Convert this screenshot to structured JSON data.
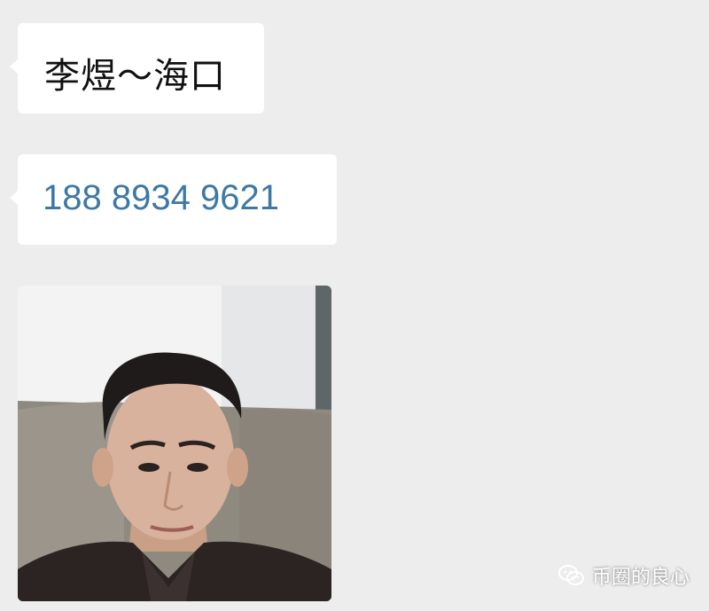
{
  "messages": {
    "name_text": "李煜～海口",
    "phone_text": "188 8934 9621"
  },
  "photo": {
    "icon": "portrait-photo"
  },
  "watermark": {
    "icon": "wechat-icon",
    "label": "币圈的良心"
  },
  "colors": {
    "background": "#ededed",
    "bubble": "#ffffff",
    "phone_link": "#3d78a6"
  }
}
